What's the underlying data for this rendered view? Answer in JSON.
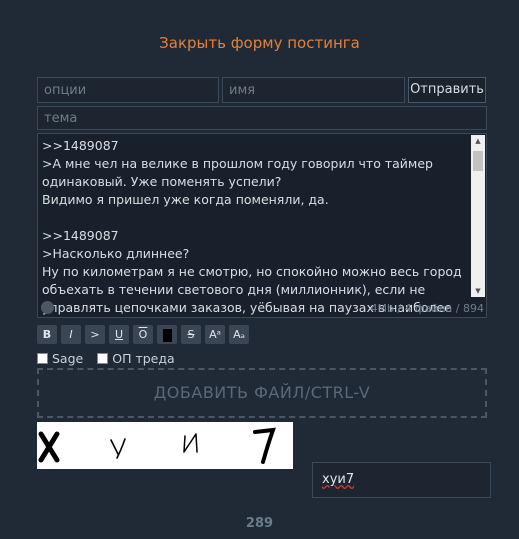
{
  "header": {
    "title": "Закрыть форму постинга"
  },
  "form": {
    "options_placeholder": "опции",
    "name_placeholder": "имя",
    "send_label": "Отправить",
    "subject_placeholder": "тема",
    "message": ">>1489087\n>А мне чел на велике в прошлом году говорил что таймер одинаковый. Уже поменять успели?\nВидимо я пришел уже когда поменяли, да.\n\n>>1489087\n>Насколько длиннее?\nНу по километрам я не смотрю, но спокойно можно весь город объехать в течении светового дня (миллионник), если не управлять цепочками заказов, уёбывая на паузах в наиболее",
    "counter": "4Mb / 4 файла / 894",
    "toolbar": [
      {
        "name": "bold-button",
        "label": "B"
      },
      {
        "name": "italic-button",
        "label": "I"
      },
      {
        "name": "quote-button",
        "label": ">"
      },
      {
        "name": "underline-button",
        "label": "U"
      },
      {
        "name": "overline-button",
        "label": "O"
      },
      {
        "name": "spoiler-button",
        "label": ""
      },
      {
        "name": "strike-button",
        "label": "S"
      },
      {
        "name": "superscript-button",
        "label": "Aᵃ"
      },
      {
        "name": "subscript-button",
        "label": "Aₐ"
      }
    ],
    "sage_label": "Sage",
    "op_label": "ОП треда",
    "dropzone_label": "ДОБАВИТЬ ФАЙЛ/CTRL-V",
    "captcha_text": "х у и 7",
    "captcha_value": "хуи7"
  },
  "footer": {
    "post_count": "289"
  },
  "colors": {
    "background": "#1f2a36",
    "accent": "#e3813c"
  }
}
